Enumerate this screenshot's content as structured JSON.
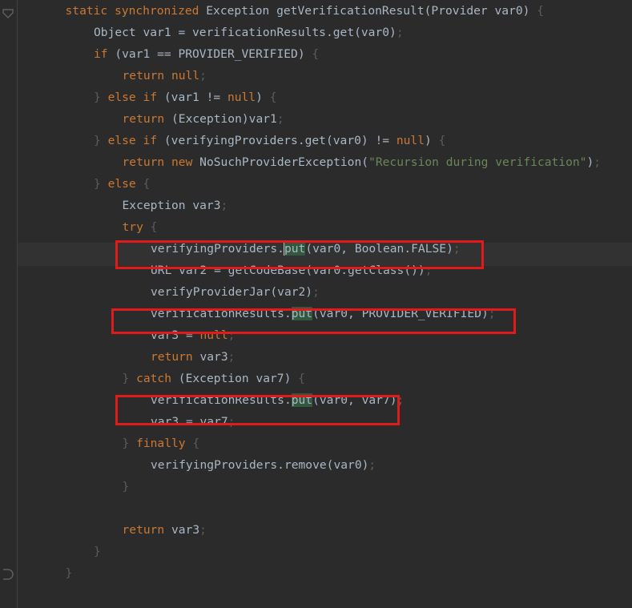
{
  "editor": {
    "app": "code-editor",
    "language": "java",
    "background_color": "#2B2B2B",
    "default_text_color": "#A9B7C6",
    "keyword_color": "#CC7832",
    "string_color": "#6A8759",
    "punctuation_color": "#5C5C5C",
    "current_line_color": "#323232",
    "find_match_color": "#32593D",
    "annotation_box_color": "#E01B1B",
    "caret_color": "#BBBBBB"
  },
  "gutter": {
    "fold_marker_top": "fold-collapse-arrow",
    "fold_marker_bottom": "fold-collapse-arrow"
  },
  "annotations": [
    {
      "name": "redbox-verifying-providers-put",
      "target_line": 12
    },
    {
      "name": "redbox-verification-results-put-verified",
      "target_line": 15
    },
    {
      "name": "redbox-verification-results-put-var7",
      "target_line": 19
    }
  ],
  "code": {
    "lines": [
      {
        "n": 1,
        "indent": 1,
        "text": "static synchronized Exception getVerificationResult(Provider var0) {",
        "tokens": [
          {
            "t": "static ",
            "c": "kw"
          },
          {
            "t": "synchronized ",
            "c": "kw"
          },
          {
            "t": "Exception getVerificationResult",
            "c": "id"
          },
          {
            "t": "(",
            "c": "pun"
          },
          {
            "t": "Provider var0",
            "c": "id"
          },
          {
            "t": ") ",
            "c": "pun"
          },
          {
            "t": "{",
            "c": "semi"
          }
        ]
      },
      {
        "n": 2,
        "indent": 2,
        "text": "Object var1 = verificationResults.get(var0);",
        "tokens": [
          {
            "t": "Object var1 ",
            "c": "id"
          },
          {
            "t": "= ",
            "c": "pun"
          },
          {
            "t": "verificationResults",
            "c": "id"
          },
          {
            "t": ".",
            "c": "pun"
          },
          {
            "t": "get",
            "c": "id"
          },
          {
            "t": "(var0)",
            "c": "pun"
          },
          {
            "t": ";",
            "c": "semi"
          }
        ]
      },
      {
        "n": 3,
        "indent": 2,
        "text": "if (var1 == PROVIDER_VERIFIED) {",
        "tokens": [
          {
            "t": "if ",
            "c": "kw"
          },
          {
            "t": "(var1 ",
            "c": "pun"
          },
          {
            "t": "== ",
            "c": "pun"
          },
          {
            "t": "PROVIDER_VERIFIED",
            "c": "id"
          },
          {
            "t": ") ",
            "c": "pun"
          },
          {
            "t": "{",
            "c": "semi"
          }
        ]
      },
      {
        "n": 4,
        "indent": 3,
        "text": "return null;",
        "tokens": [
          {
            "t": "return ",
            "c": "kw"
          },
          {
            "t": "null",
            "c": "kw"
          },
          {
            "t": ";",
            "c": "semi"
          }
        ]
      },
      {
        "n": 5,
        "indent": 2,
        "text": "} else if (var1 != null) {",
        "tokens": [
          {
            "t": "} ",
            "c": "semi"
          },
          {
            "t": "else ",
            "c": "kw"
          },
          {
            "t": "if ",
            "c": "kw"
          },
          {
            "t": "(var1 ",
            "c": "pun"
          },
          {
            "t": "!= ",
            "c": "pun"
          },
          {
            "t": "null",
            "c": "kw"
          },
          {
            "t": ") ",
            "c": "pun"
          },
          {
            "t": "{",
            "c": "semi"
          }
        ]
      },
      {
        "n": 6,
        "indent": 3,
        "text": "return (Exception)var1;",
        "tokens": [
          {
            "t": "return ",
            "c": "kw"
          },
          {
            "t": "(Exception)var1",
            "c": "id"
          },
          {
            "t": ";",
            "c": "semi"
          }
        ]
      },
      {
        "n": 7,
        "indent": 2,
        "text": "} else if (verifyingProviders.get(var0) != null) {",
        "tokens": [
          {
            "t": "} ",
            "c": "semi"
          },
          {
            "t": "else ",
            "c": "kw"
          },
          {
            "t": "if ",
            "c": "kw"
          },
          {
            "t": "(verifyingProviders",
            "c": "id"
          },
          {
            "t": ".",
            "c": "pun"
          },
          {
            "t": "get",
            "c": "id"
          },
          {
            "t": "(var0) ",
            "c": "pun"
          },
          {
            "t": "!= ",
            "c": "pun"
          },
          {
            "t": "null",
            "c": "kw"
          },
          {
            "t": ") ",
            "c": "pun"
          },
          {
            "t": "{",
            "c": "semi"
          }
        ]
      },
      {
        "n": 8,
        "indent": 3,
        "text": "return new NoSuchProviderException(\"Recursion during verification\");",
        "tokens": [
          {
            "t": "return ",
            "c": "kw"
          },
          {
            "t": "new ",
            "c": "kw"
          },
          {
            "t": "NoSuchProviderException",
            "c": "id"
          },
          {
            "t": "(",
            "c": "pun"
          },
          {
            "t": "\"Recursion during verification\"",
            "c": "str"
          },
          {
            "t": ")",
            "c": "pun"
          },
          {
            "t": ";",
            "c": "semi"
          }
        ]
      },
      {
        "n": 9,
        "indent": 2,
        "text": "} else {",
        "tokens": [
          {
            "t": "} ",
            "c": "semi"
          },
          {
            "t": "else ",
            "c": "kw"
          },
          {
            "t": "{",
            "c": "semi"
          }
        ]
      },
      {
        "n": 10,
        "indent": 3,
        "text": "Exception var3;",
        "tokens": [
          {
            "t": "Exception var3",
            "c": "id"
          },
          {
            "t": ";",
            "c": "semi"
          }
        ]
      },
      {
        "n": 11,
        "indent": 3,
        "text": "try {",
        "tokens": [
          {
            "t": "try ",
            "c": "kw"
          },
          {
            "t": "{",
            "c": "semi"
          }
        ]
      },
      {
        "n": 12,
        "indent": 4,
        "highlighted": true,
        "text": "verifyingProviders.put(var0, Boolean.FALSE);",
        "tokens": [
          {
            "t": "verifyingProviders",
            "c": "id"
          },
          {
            "t": ".",
            "c": "pun"
          },
          {
            "t": "CARET",
            "c": "caret"
          },
          {
            "t": "put",
            "c": "match"
          },
          {
            "t": "(var0, ",
            "c": "pun"
          },
          {
            "t": "Boolean",
            "c": "id"
          },
          {
            "t": ".",
            "c": "pun"
          },
          {
            "t": "FALSE",
            "c": "id"
          },
          {
            "t": ")",
            "c": "pun"
          },
          {
            "t": ";",
            "c": "semi"
          }
        ]
      },
      {
        "n": 13,
        "indent": 4,
        "text": "URL var2 = getCodeBase(var0.getClass());",
        "tokens": [
          {
            "t": "URL var2 ",
            "c": "id"
          },
          {
            "t": "= ",
            "c": "pun"
          },
          {
            "t": "getCodeBase",
            "c": "id"
          },
          {
            "t": "(var0",
            "c": "pun"
          },
          {
            "t": ".",
            "c": "pun"
          },
          {
            "t": "getClass",
            "c": "id"
          },
          {
            "t": "())",
            "c": "pun"
          },
          {
            "t": ";",
            "c": "semi"
          }
        ]
      },
      {
        "n": 14,
        "indent": 4,
        "text": "verifyProviderJar(var2);",
        "tokens": [
          {
            "t": "verifyProviderJar",
            "c": "id"
          },
          {
            "t": "(var2)",
            "c": "pun"
          },
          {
            "t": ";",
            "c": "semi"
          }
        ]
      },
      {
        "n": 15,
        "indent": 4,
        "text": "verificationResults.put(var0, PROVIDER_VERIFIED);",
        "tokens": [
          {
            "t": "verificationResults",
            "c": "id"
          },
          {
            "t": ".",
            "c": "pun"
          },
          {
            "t": "put",
            "c": "match"
          },
          {
            "t": "(var0, ",
            "c": "pun"
          },
          {
            "t": "PROVIDER_VERIFIED",
            "c": "id"
          },
          {
            "t": ")",
            "c": "pun"
          },
          {
            "t": ";",
            "c": "semi"
          }
        ]
      },
      {
        "n": 16,
        "indent": 4,
        "text": "var3 = null;",
        "tokens": [
          {
            "t": "var3 ",
            "c": "id"
          },
          {
            "t": "= ",
            "c": "pun"
          },
          {
            "t": "null",
            "c": "kw"
          },
          {
            "t": ";",
            "c": "semi"
          }
        ]
      },
      {
        "n": 17,
        "indent": 4,
        "text": "return var3;",
        "tokens": [
          {
            "t": "return ",
            "c": "kw"
          },
          {
            "t": "var3",
            "c": "id"
          },
          {
            "t": ";",
            "c": "semi"
          }
        ]
      },
      {
        "n": 18,
        "indent": 3,
        "text": "} catch (Exception var7) {",
        "tokens": [
          {
            "t": "} ",
            "c": "semi"
          },
          {
            "t": "catch ",
            "c": "kw"
          },
          {
            "t": "(Exception var7",
            "c": "id"
          },
          {
            "t": ") ",
            "c": "pun"
          },
          {
            "t": "{",
            "c": "semi"
          }
        ]
      },
      {
        "n": 19,
        "indent": 4,
        "text": "verificationResults.put(var0, var7);",
        "tokens": [
          {
            "t": "verificationResults",
            "c": "id"
          },
          {
            "t": ".",
            "c": "pun"
          },
          {
            "t": "put",
            "c": "match"
          },
          {
            "t": "(var0, ",
            "c": "pun"
          },
          {
            "t": "var7",
            "c": "id"
          },
          {
            "t": ")",
            "c": "pun"
          },
          {
            "t": ";",
            "c": "semi"
          }
        ]
      },
      {
        "n": 20,
        "indent": 4,
        "text": "var3 = var7;",
        "tokens": [
          {
            "t": "var3 ",
            "c": "id"
          },
          {
            "t": "= ",
            "c": "pun"
          },
          {
            "t": "var7",
            "c": "id"
          },
          {
            "t": ";",
            "c": "semi"
          }
        ]
      },
      {
        "n": 21,
        "indent": 3,
        "text": "} finally {",
        "tokens": [
          {
            "t": "} ",
            "c": "semi"
          },
          {
            "t": "finally ",
            "c": "kw"
          },
          {
            "t": "{",
            "c": "semi"
          }
        ]
      },
      {
        "n": 22,
        "indent": 4,
        "text": "verifyingProviders.remove(var0);",
        "tokens": [
          {
            "t": "verifyingProviders",
            "c": "id"
          },
          {
            "t": ".",
            "c": "pun"
          },
          {
            "t": "remove",
            "c": "id"
          },
          {
            "t": "(var0)",
            "c": "pun"
          },
          {
            "t": ";",
            "c": "semi"
          }
        ]
      },
      {
        "n": 23,
        "indent": 3,
        "text": "}",
        "tokens": [
          {
            "t": "}",
            "c": "semi"
          }
        ]
      },
      {
        "n": 24,
        "indent": 0,
        "text": "",
        "tokens": []
      },
      {
        "n": 25,
        "indent": 3,
        "text": "return var3;",
        "tokens": [
          {
            "t": "return ",
            "c": "kw"
          },
          {
            "t": "var3",
            "c": "id"
          },
          {
            "t": ";",
            "c": "semi"
          }
        ]
      },
      {
        "n": 26,
        "indent": 2,
        "text": "}",
        "tokens": [
          {
            "t": "}",
            "c": "semi"
          }
        ]
      },
      {
        "n": 27,
        "indent": 1,
        "text": "}",
        "tokens": [
          {
            "t": "}",
            "c": "semi"
          }
        ]
      }
    ]
  }
}
